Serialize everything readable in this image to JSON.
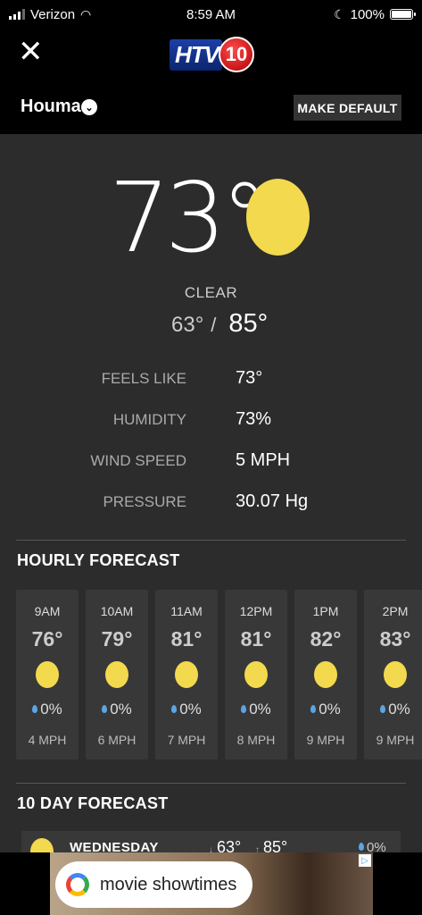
{
  "status": {
    "carrier": "Verizon",
    "time": "8:59 AM",
    "battery": "100%"
  },
  "header": {
    "logo_text": "HTV",
    "logo_num": "10",
    "close_label": "✕"
  },
  "location": {
    "name": "Houma",
    "make_default_label": "MAKE DEFAULT"
  },
  "current": {
    "temp": "73°",
    "condition": "CLEAR",
    "low": "63°",
    "separator": "/",
    "high": "85°",
    "details": [
      {
        "label": "FEELS LIKE",
        "value": "73°"
      },
      {
        "label": "HUMIDITY",
        "value": "73%"
      },
      {
        "label": "WIND SPEED",
        "value": "5 MPH"
      },
      {
        "label": "PRESSURE",
        "value": "30.07 Hg"
      }
    ]
  },
  "hourly": {
    "title": "HOURLY FORECAST",
    "items": [
      {
        "time": "9AM",
        "temp": "76°",
        "precip": "0%",
        "wind": "4 MPH",
        "icon": "sun-icon"
      },
      {
        "time": "10AM",
        "temp": "79°",
        "precip": "0%",
        "wind": "6 MPH",
        "icon": "sun-icon"
      },
      {
        "time": "11AM",
        "temp": "81°",
        "precip": "0%",
        "wind": "7 MPH",
        "icon": "sun-icon"
      },
      {
        "time": "12PM",
        "temp": "81°",
        "precip": "0%",
        "wind": "8 MPH",
        "icon": "sun-icon"
      },
      {
        "time": "1PM",
        "temp": "82°",
        "precip": "0%",
        "wind": "9 MPH",
        "icon": "sun-icon"
      },
      {
        "time": "2PM",
        "temp": "83°",
        "precip": "0%",
        "wind": "9 MPH",
        "icon": "sun-icon"
      }
    ]
  },
  "ten_day": {
    "title": "10 DAY FORECAST",
    "first_day": {
      "name": "WEDNESDAY",
      "low": "63°",
      "high": "85°",
      "precip": "0%"
    }
  },
  "ad": {
    "text": "movie showtimes"
  },
  "colors": {
    "sun": "#f2d94e",
    "panel": "#2c2c2c",
    "card": "#383838",
    "drop": "#5aa6e6"
  }
}
